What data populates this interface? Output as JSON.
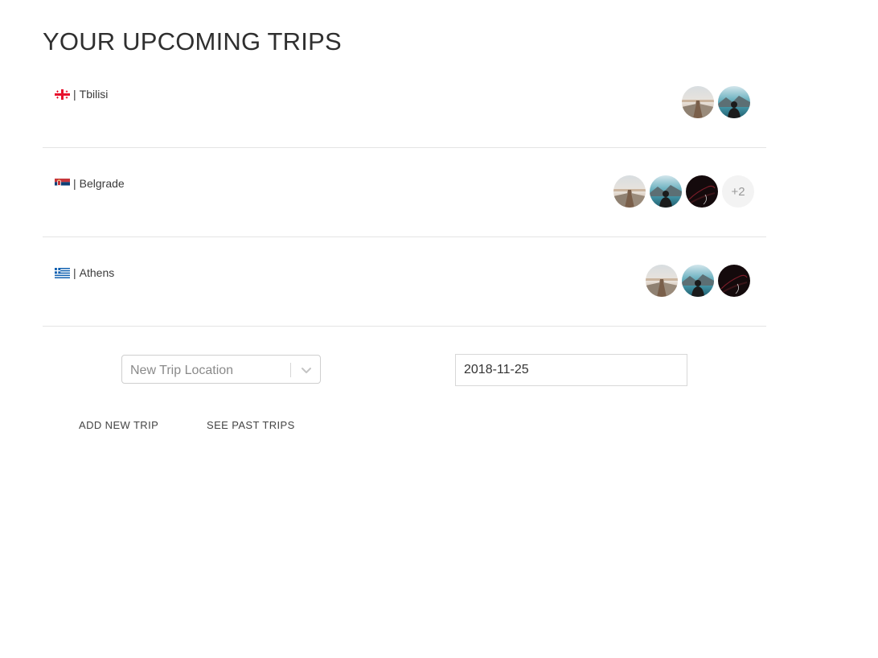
{
  "page": {
    "title": "YOUR UPCOMING TRIPS"
  },
  "trips": [
    {
      "flag_icon": "georgia-flag-icon",
      "city": "Tbilisi",
      "avatars": [
        "pier-photo",
        "traveler-lake-photo"
      ],
      "more": ""
    },
    {
      "flag_icon": "serbia-flag-icon",
      "city": "Belgrade",
      "avatars": [
        "pier-photo",
        "traveler-lake-photo",
        "car-dark-photo"
      ],
      "more": "+2"
    },
    {
      "flag_icon": "greece-flag-icon",
      "city": "Athens",
      "avatars": [
        "pier-photo",
        "traveler-lake-photo",
        "car-dark-photo"
      ],
      "more": ""
    }
  ],
  "separator": "|",
  "form": {
    "location_placeholder": "New Trip Location",
    "date_value": "2018-11-25"
  },
  "actions": {
    "add_label": "ADD NEW TRIP",
    "past_label": "SEE PAST TRIPS"
  }
}
